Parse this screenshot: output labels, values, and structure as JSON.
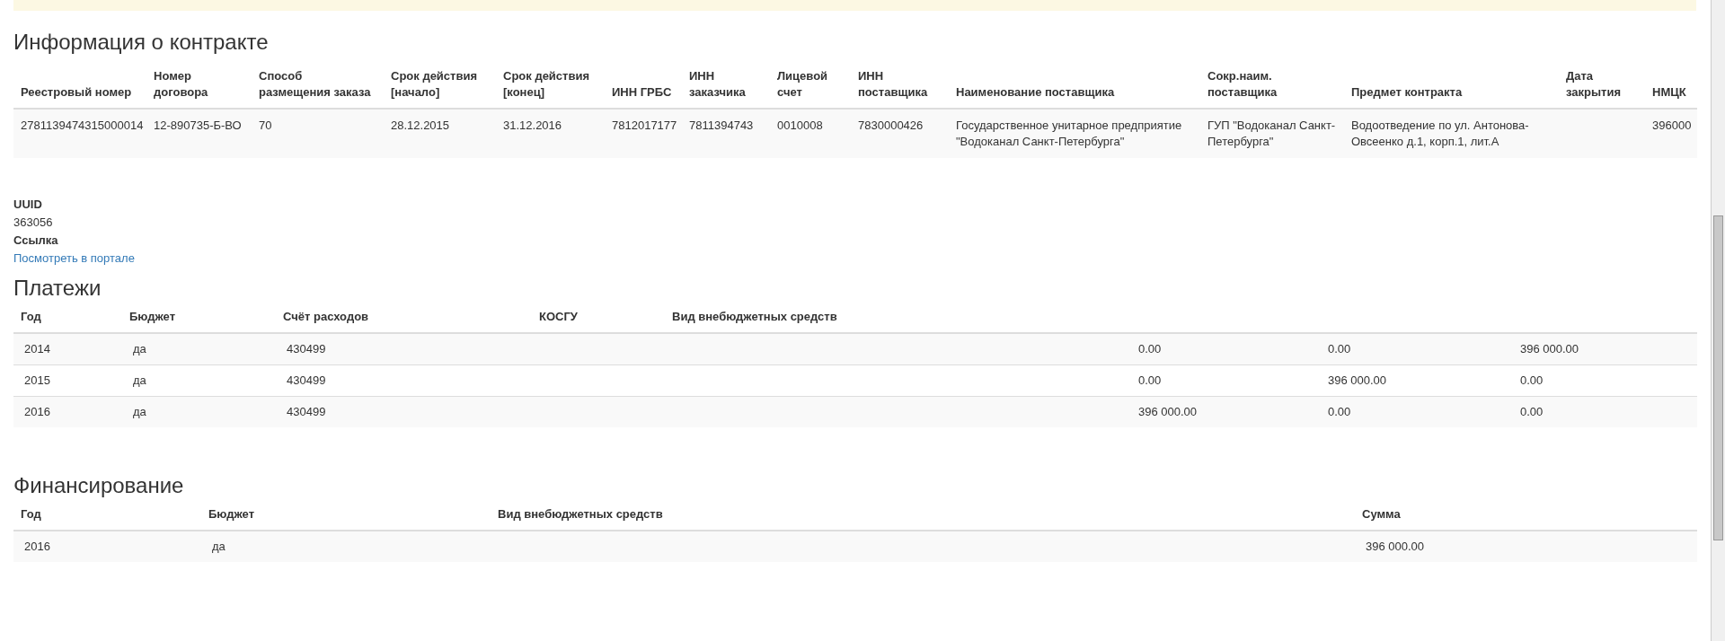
{
  "contract": {
    "title": "Информация о контракте",
    "columns": [
      "Реестровый номер",
      "Номер договора",
      "Способ размещения заказа",
      "Срок действия [начало]",
      "Срок действия [конец]",
      "ИНН ГРБС",
      "ИНН заказчика",
      "Лицевой счет",
      "ИНН поставщика",
      "Наименование поставщика",
      "Сокр.наим. поставщика",
      "Предмет контракта",
      "Дата закрытия",
      "НМЦК"
    ],
    "rows": [
      {
        "cells": [
          "2781139474315000014",
          "12-890735-Б-ВО",
          "70",
          "28.12.2015",
          "31.12.2016",
          "7812017177",
          "7811394743",
          "0010008",
          "7830000426",
          "Государственное унитарное предприятие \"Водоканал Санкт-Петербурга\"",
          "ГУП \"Водоканал Санкт-Петербурга\"",
          "Водоотведение по ул. Антонова-Овсеенко д.1, корп.1, лит.А",
          null,
          "396000"
        ]
      }
    ]
  },
  "details": [
    {
      "label": "UUID",
      "value": "363056",
      "kind": "text"
    },
    {
      "label": "Ссылка",
      "value": "Посмотреть в портале",
      "kind": "link"
    }
  ],
  "payments": {
    "title": "Платежи",
    "columns": [
      "Год",
      "Бюджет",
      "Счёт расходов",
      "КОСГУ",
      "Вид внебюджетных средств",
      null,
      null,
      null
    ],
    "rows": [
      {
        "cells": [
          "2014",
          "да",
          "430499",
          null,
          null,
          "0.00",
          "0.00",
          "396 000.00"
        ]
      },
      {
        "cells": [
          "2015",
          "да",
          "430499",
          null,
          null,
          "0.00",
          "396 000.00",
          "0.00"
        ]
      },
      {
        "cells": [
          "2016",
          "да",
          "430499",
          null,
          null,
          "396 000.00",
          "0.00",
          "0.00"
        ]
      }
    ]
  },
  "financing": {
    "title": "Финансирование",
    "columns": [
      "Год",
      "Бюджет",
      "Вид внебюджетных средств",
      "Сумма"
    ],
    "rows": [
      {
        "cells": [
          "2016",
          "да",
          null,
          "396 000.00"
        ]
      }
    ]
  }
}
